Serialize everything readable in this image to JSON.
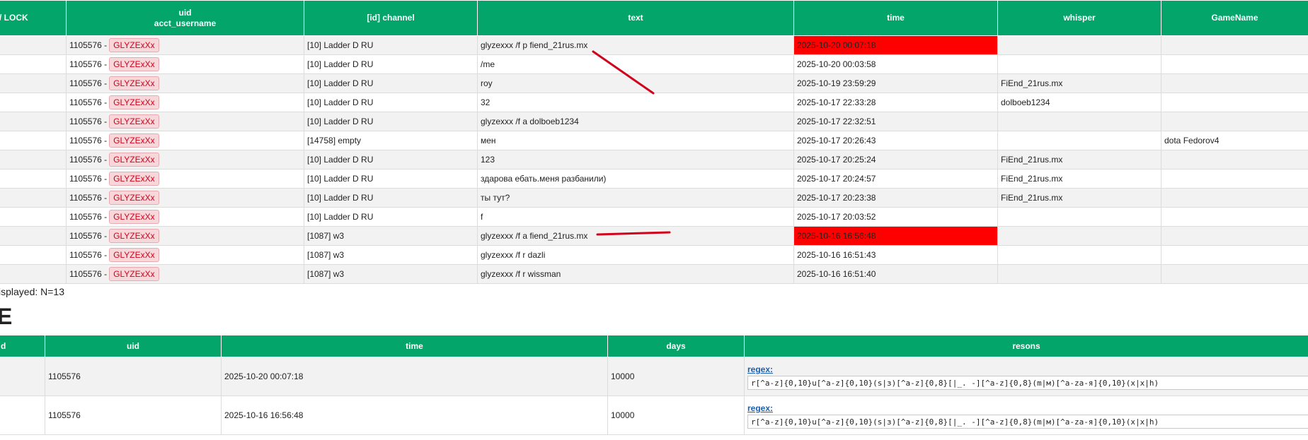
{
  "log_table": {
    "headers": [
      "/ LOCK",
      "uid\nacct_username",
      "[id] channel",
      "text",
      "time",
      "whisper",
      "GameName"
    ],
    "rows": [
      {
        "uid": "1105576 -",
        "user": "GLYZExXx",
        "channel": "[10] Ladder D RU",
        "text": "glyzexxx /f p fiend_21rus.mx",
        "time": "2025-10-20 00:07:18",
        "whisper": "",
        "game": "",
        "highlight": true
      },
      {
        "uid": "1105576 -",
        "user": "GLYZExXx",
        "channel": "[10] Ladder D RU",
        "text": "/me",
        "time": "2025-10-20 00:03:58",
        "whisper": "",
        "game": "",
        "highlight": false
      },
      {
        "uid": "1105576 -",
        "user": "GLYZExXx",
        "channel": "[10] Ladder D RU",
        "text": "roy",
        "time": "2025-10-19 23:59:29",
        "whisper": "FiEnd_21rus.mx",
        "game": "",
        "highlight": false
      },
      {
        "uid": "1105576 -",
        "user": "GLYZExXx",
        "channel": "[10] Ladder D RU",
        "text": "32",
        "time": "2025-10-17 22:33:28",
        "whisper": "dolboeb1234",
        "game": "",
        "highlight": false
      },
      {
        "uid": "1105576 -",
        "user": "GLYZExXx",
        "channel": "[10] Ladder D RU",
        "text": "glyzexxx /f a dolboeb1234",
        "time": "2025-10-17 22:32:51",
        "whisper": "",
        "game": "",
        "highlight": false
      },
      {
        "uid": "1105576 -",
        "user": "GLYZExXx",
        "channel": "[14758] empty",
        "text": "мен",
        "time": "2025-10-17 20:26:43",
        "whisper": "",
        "game": "dota Fedorov4",
        "highlight": false
      },
      {
        "uid": "1105576 -",
        "user": "GLYZExXx",
        "channel": "[10] Ladder D RU",
        "text": "123",
        "time": "2025-10-17 20:25:24",
        "whisper": "FiEnd_21rus.mx",
        "game": "",
        "highlight": false
      },
      {
        "uid": "1105576 -",
        "user": "GLYZExXx",
        "channel": "[10] Ladder D RU",
        "text": "здарова ебать.меня разбанили)",
        "time": "2025-10-17 20:24:57",
        "whisper": "FiEnd_21rus.mx",
        "game": "",
        "highlight": false
      },
      {
        "uid": "1105576 -",
        "user": "GLYZExXx",
        "channel": "[10] Ladder D RU",
        "text": "ты тут?",
        "time": "2025-10-17 20:23:38",
        "whisper": "FiEnd_21rus.mx",
        "game": "",
        "highlight": false
      },
      {
        "uid": "1105576 -",
        "user": "GLYZExXx",
        "channel": "[10] Ladder D RU",
        "text": "f",
        "time": "2025-10-17 20:03:52",
        "whisper": "",
        "game": "",
        "highlight": false
      },
      {
        "uid": "1105576 -",
        "user": "GLYZExXx",
        "channel": "[1087] w3",
        "text": "glyzexxx /f a fiend_21rus.mx",
        "time": "2025-10-16 16:56:48",
        "whisper": "",
        "game": "",
        "highlight": true
      },
      {
        "uid": "1105576 -",
        "user": "GLYZExXx",
        "channel": "[1087] w3",
        "text": "glyzexxx /f r dazli",
        "time": "2025-10-16 16:51:43",
        "whisper": "",
        "game": "",
        "highlight": false
      },
      {
        "uid": "1105576 -",
        "user": "GLYZExXx",
        "channel": "[1087] w3",
        "text": "glyzexxx /f r wissman",
        "time": "2025-10-16 16:51:40",
        "whisper": "",
        "game": "",
        "highlight": false
      }
    ]
  },
  "count_line": "isplayed: N=13",
  "ban_heading": "E",
  "ban_table": {
    "headers": [
      "d",
      "uid",
      "time",
      "days",
      "resons"
    ],
    "regex_label": "regex:",
    "rows": [
      {
        "uid": "1105576",
        "time": "2025-10-20 00:07:18",
        "days": "10000",
        "regex": "r[^a-z]{0,10}u[^a-z]{0,10}(s|з)[^a-z]{0,8}[|_. -][^a-z]{0,8}(m|м)[^a-zа-я]{0,10}(x|х|h)"
      },
      {
        "uid": "1105576",
        "time": "2025-10-16 16:56:48",
        "days": "10000",
        "regex": "r[^a-z]{0,10}u[^a-z]{0,10}(s|з)[^a-z]{0,8}[|_. -][^a-z]{0,8}(m|м)[^a-zа-я]{0,10}(x|х|h)"
      }
    ]
  },
  "colors": {
    "header_bg": "#04a56b",
    "highlight": "#ff0000",
    "tag_bg": "#f8d7da",
    "tag_text": "#d0021b",
    "annotation": "#d0021b"
  }
}
